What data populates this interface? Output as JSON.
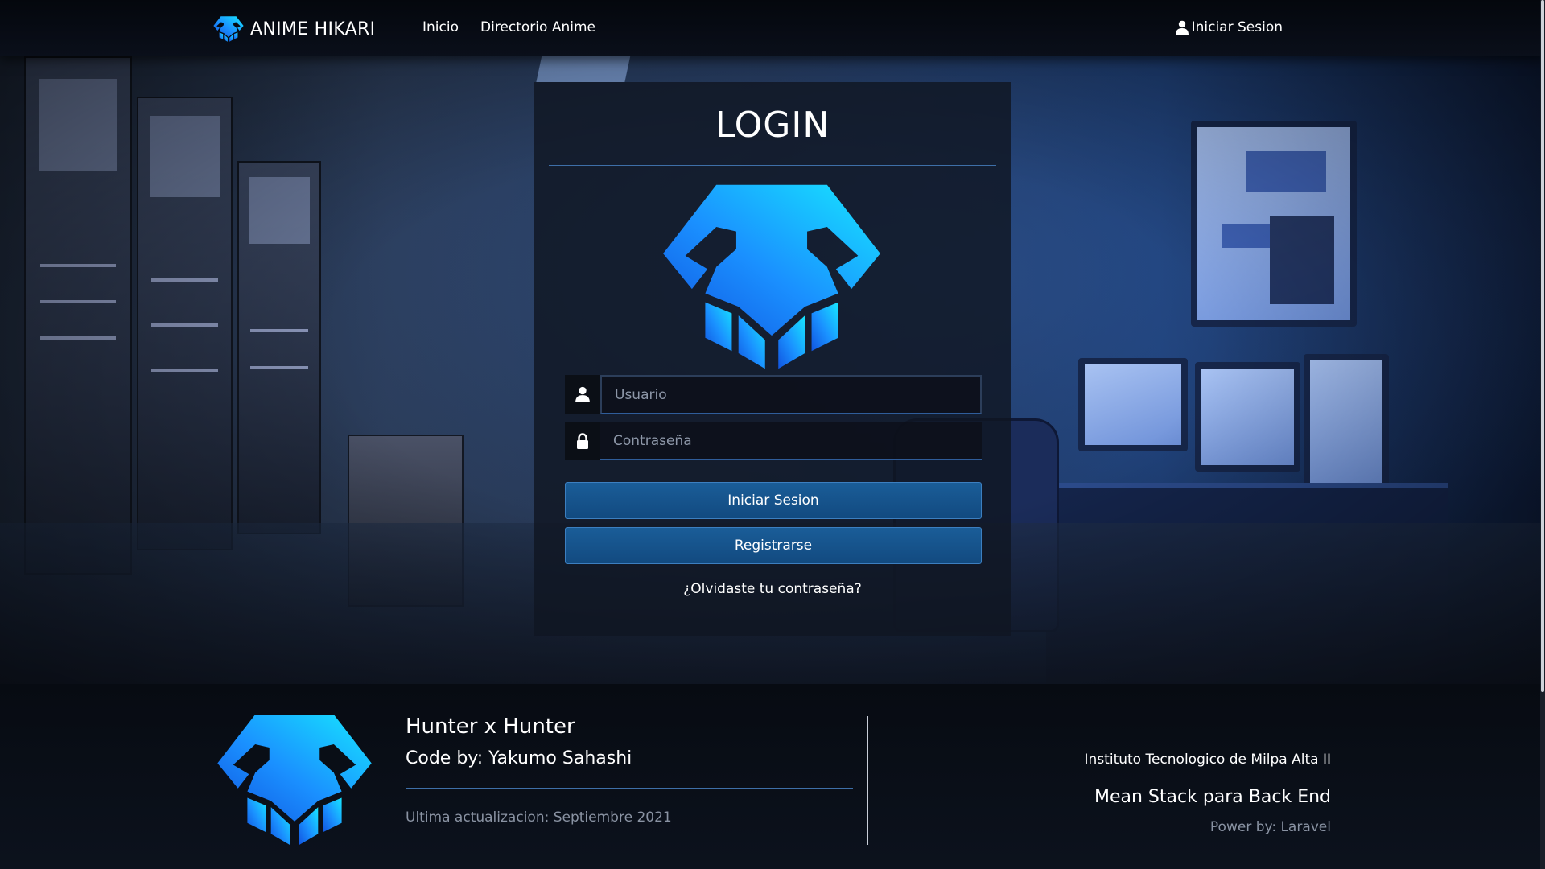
{
  "nav": {
    "brand": "ANIME HIKARI",
    "links": [
      {
        "label": "Inicio"
      },
      {
        "label": "Directorio Anime"
      }
    ],
    "login_label": "Iniciar Sesion"
  },
  "login": {
    "title": "LOGIN",
    "username_placeholder": "Usuario",
    "password_placeholder": "Contraseña",
    "submit_label": "Iniciar Sesion",
    "register_label": "Registrarse",
    "forgot_label": "¿Olvidaste tu contraseña?"
  },
  "footer": {
    "title": "Hunter x Hunter",
    "author": "Code by: Yakumo Sahashi",
    "updated": "Ultima actualizacion: Septiembre 2021",
    "institution": "Instituto Tecnologico de Milpa Alta II",
    "stack": "Mean Stack para Back End",
    "powered": "Power by: Laravel"
  },
  "colors": {
    "accent": "#1a5d98",
    "logo_gradient_start": "#17e6ff",
    "logo_gradient_end": "#1155e0",
    "divider": "#3e6fa8"
  },
  "icons": {
    "brand": "skull-logo-icon",
    "nav_login": "user-icon",
    "username": "user-icon",
    "password": "lock-icon"
  }
}
